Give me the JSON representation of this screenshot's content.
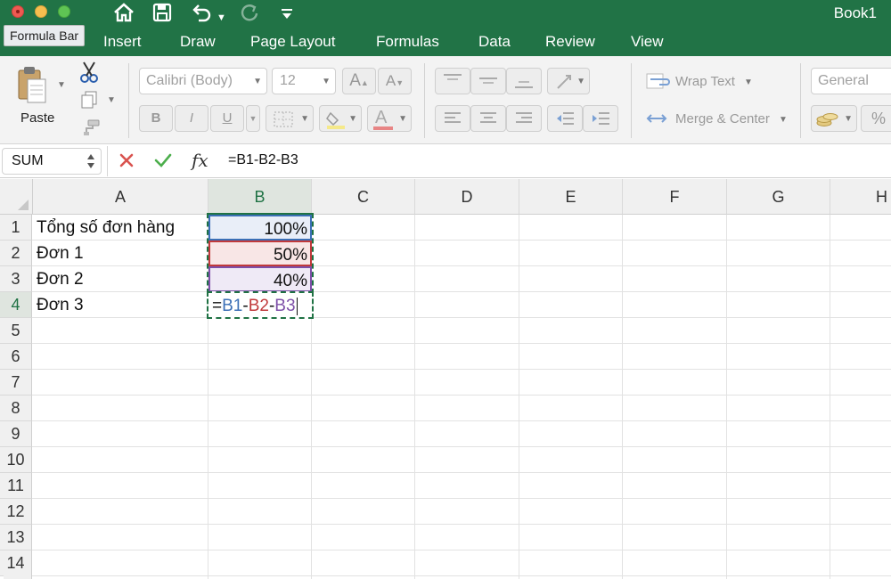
{
  "window": {
    "title": "Book1"
  },
  "tooltip": "Formula Bar",
  "tabs": [
    {
      "label": "Insert"
    },
    {
      "label": "Draw"
    },
    {
      "label": "Page Layout"
    },
    {
      "label": "Formulas"
    },
    {
      "label": "Data"
    },
    {
      "label": "Review"
    },
    {
      "label": "View"
    }
  ],
  "ribbon": {
    "paste_label": "Paste",
    "font_name": "Calibri (Body)",
    "font_size": "12",
    "bold": "B",
    "italic": "I",
    "underline": "U",
    "wrap_text": "Wrap Text",
    "merge_center": "Merge & Center",
    "number_format": "General",
    "percent": "%"
  },
  "formula_bar": {
    "name_box": "SUM",
    "fx": "fx",
    "formula": "=B1-B2-B3"
  },
  "sheet": {
    "columns": [
      "A",
      "B",
      "C",
      "D",
      "E",
      "F",
      "G",
      "H"
    ],
    "rows": [
      "1",
      "2",
      "3",
      "4",
      "5",
      "6",
      "7",
      "8",
      "9",
      "10",
      "11",
      "12",
      "13",
      "14"
    ],
    "cells": {
      "A1": "Tổng số đơn hàng",
      "A2": "Đơn 1",
      "A3": "Đơn 2",
      "A4": "Đơn 3",
      "B1": "100%",
      "B2": "50%",
      "B3": "40%"
    },
    "edit_cell": {
      "eq": "=",
      "ref1": "B1",
      "op1": "-",
      "ref2": "B2",
      "op2": "-",
      "ref3": "B3"
    }
  },
  "colors": {
    "brand": "#217346",
    "ref_blue": "#3b6fb6",
    "ref_red": "#c0393b",
    "ref_purple": "#7d4fa8",
    "active_green": "#1f7244"
  }
}
